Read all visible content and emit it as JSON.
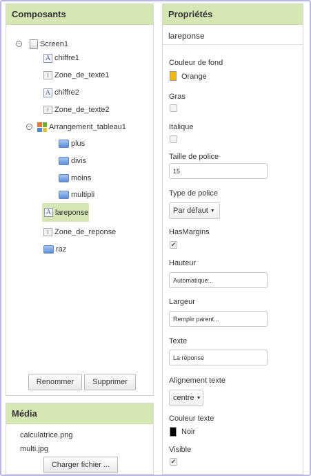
{
  "components": {
    "title": "Composants",
    "tree": [
      {
        "label": "Screen1",
        "type": "screen"
      },
      {
        "label": "chiffre1",
        "type": "label"
      },
      {
        "label": "Zone_de_texte1",
        "type": "textbox"
      },
      {
        "label": "chiffre2",
        "type": "label"
      },
      {
        "label": "Zone_de_texte2",
        "type": "textbox"
      },
      {
        "label": "Arrangement_tableau1",
        "type": "table"
      },
      {
        "label": "plus",
        "type": "button"
      },
      {
        "label": "divis",
        "type": "button"
      },
      {
        "label": "moins",
        "type": "button"
      },
      {
        "label": "multipli",
        "type": "button"
      },
      {
        "label": "lareponse",
        "type": "label",
        "selected": true
      },
      {
        "label": "Zone_de_reponse",
        "type": "textbox"
      },
      {
        "label": "raz",
        "type": "button"
      }
    ],
    "rename_label": "Renommer",
    "delete_label": "Supprimer"
  },
  "media": {
    "title": "Média",
    "files": [
      "calculatrice.png",
      "multi.jpg"
    ],
    "upload_label": "Charger fichier ..."
  },
  "properties": {
    "title": "Propriétés",
    "component_name": "lareponse",
    "background_color_label": "Couleur de fond",
    "background_color_value": "Orange",
    "background_color_hex": "#f5b800",
    "bold_label": "Gras",
    "bold_checked": false,
    "italic_label": "Italique",
    "italic_checked": false,
    "font_size_label": "Taille de police",
    "font_size_value": "15",
    "font_type_label": "Type de police",
    "font_type_value": "Par défaut",
    "has_margins_label": "HasMargins",
    "has_margins_checked": true,
    "height_label": "Hauteur",
    "height_value": "Automatique...",
    "width_label": "Largeur",
    "width_value": "Remplir parent...",
    "text_label": "Texte",
    "text_value": "La réponse",
    "text_align_label": "Alignement texte",
    "text_align_value": "centre",
    "text_color_label": "Couleur texte",
    "text_color_value": "Noir",
    "text_color_hex": "#000000",
    "visible_label": "Visible",
    "visible_checked": true
  }
}
